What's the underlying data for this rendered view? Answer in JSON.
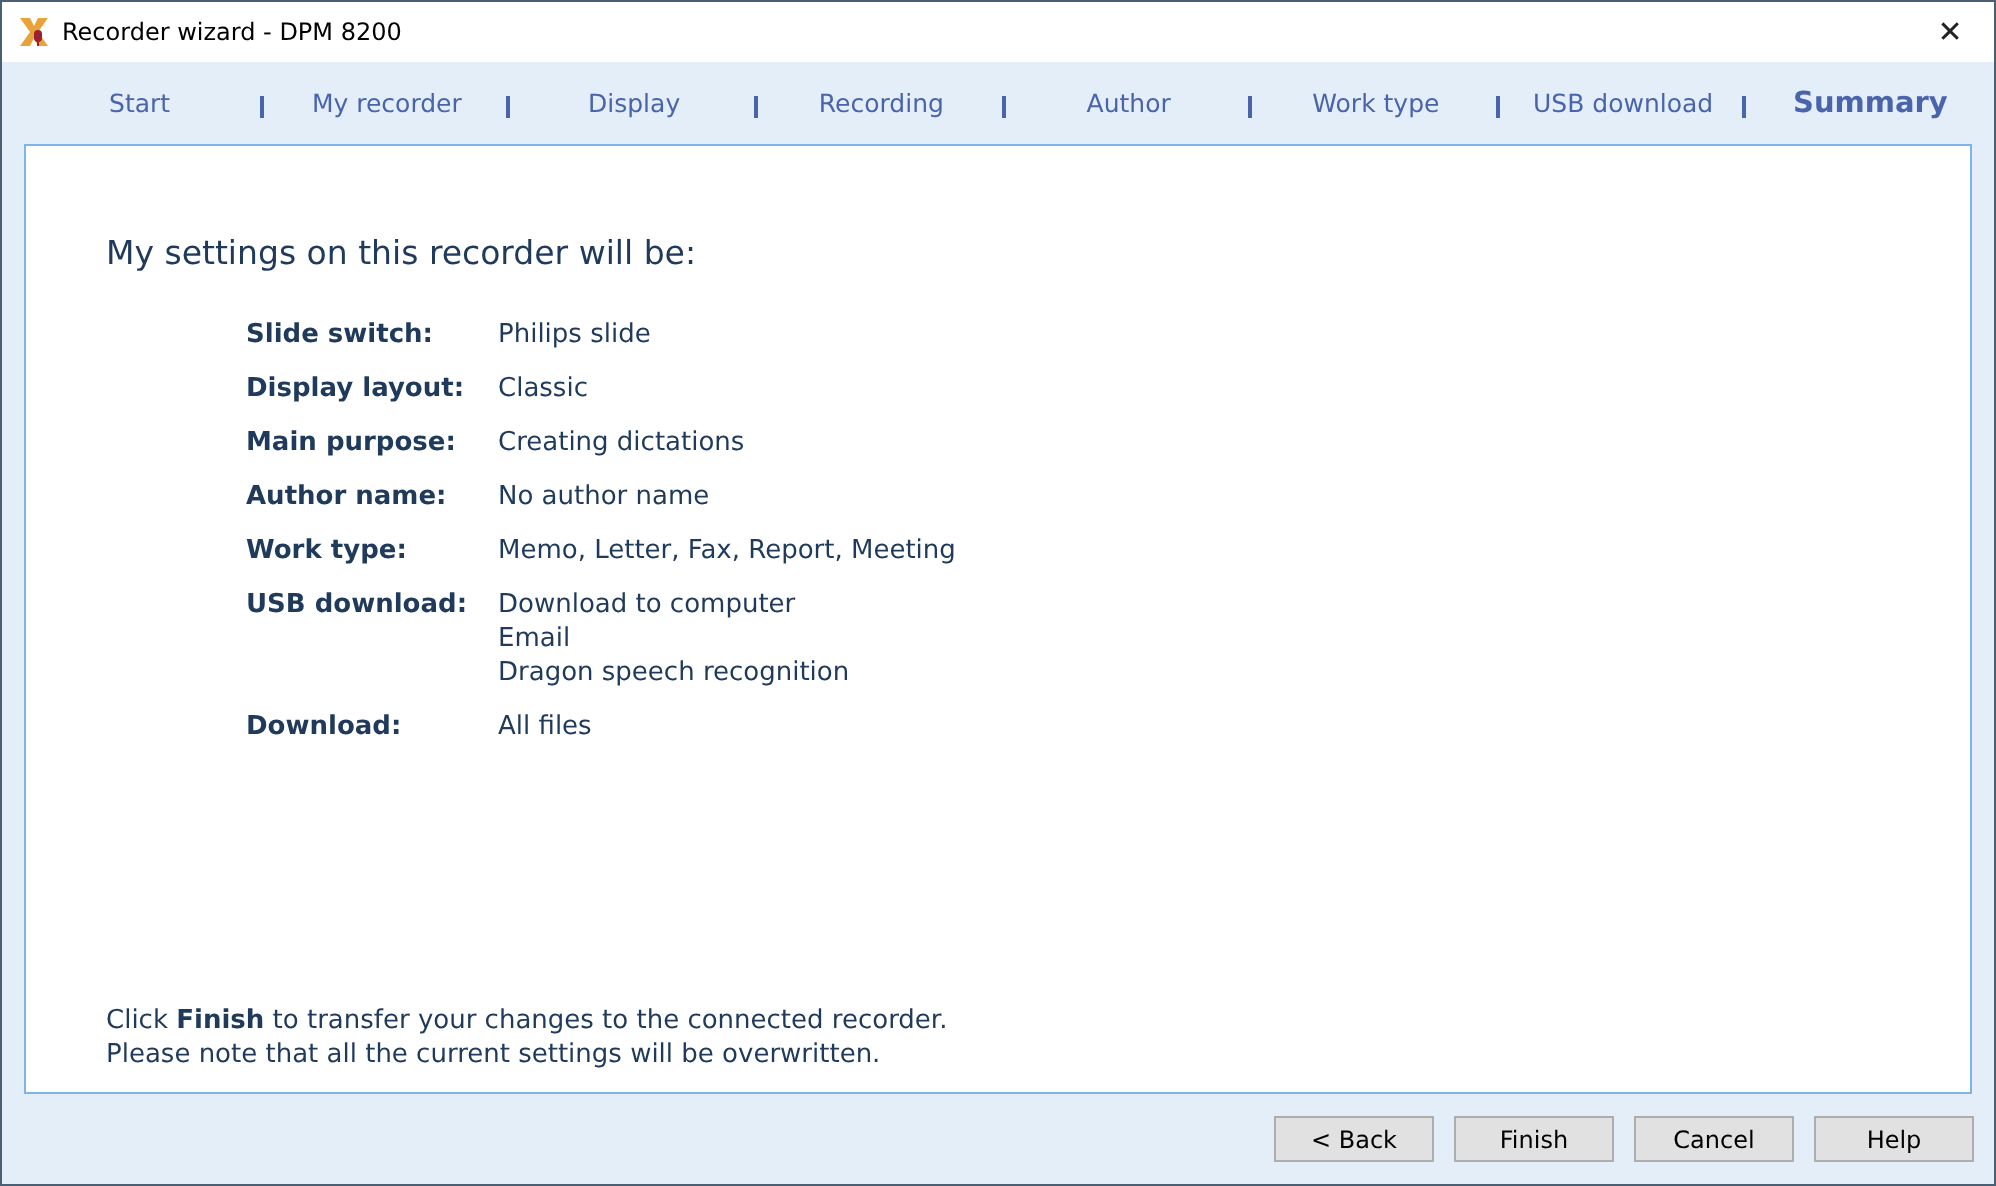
{
  "window": {
    "title": "Recorder wizard - DPM 8200",
    "close": "✕"
  },
  "steps": [
    {
      "label": "Start",
      "selected": false
    },
    {
      "label": "My recorder",
      "selected": false
    },
    {
      "label": "Display",
      "selected": false
    },
    {
      "label": "Recording",
      "selected": false
    },
    {
      "label": "Author",
      "selected": false
    },
    {
      "label": "Work type",
      "selected": false
    },
    {
      "label": "USB download",
      "selected": false
    },
    {
      "label": "Summary",
      "selected": true
    }
  ],
  "heading": "My settings on this recorder will be:",
  "settings": [
    {
      "label": "Slide switch:",
      "values": [
        "Philips slide"
      ]
    },
    {
      "label": "Display layout:",
      "values": [
        "Classic"
      ]
    },
    {
      "label": "Main purpose:",
      "values": [
        "Creating dictations"
      ]
    },
    {
      "label": "Author name:",
      "values": [
        "No author name"
      ]
    },
    {
      "label": "Work type:",
      "values": [
        "Memo, Letter, Fax, Report, Meeting"
      ]
    },
    {
      "label": "USB download:",
      "values": [
        "Download to computer",
        "Email",
        "Dragon speech recognition"
      ]
    },
    {
      "label": "Download:",
      "values": [
        "All files"
      ]
    }
  ],
  "notes": [
    "Click **Finish** to transfer your changes to the connected recorder.",
    "Please note that all the current settings will be overwritten."
  ],
  "buttons": [
    "< Back",
    "Finish",
    "Cancel",
    "Help"
  ]
}
